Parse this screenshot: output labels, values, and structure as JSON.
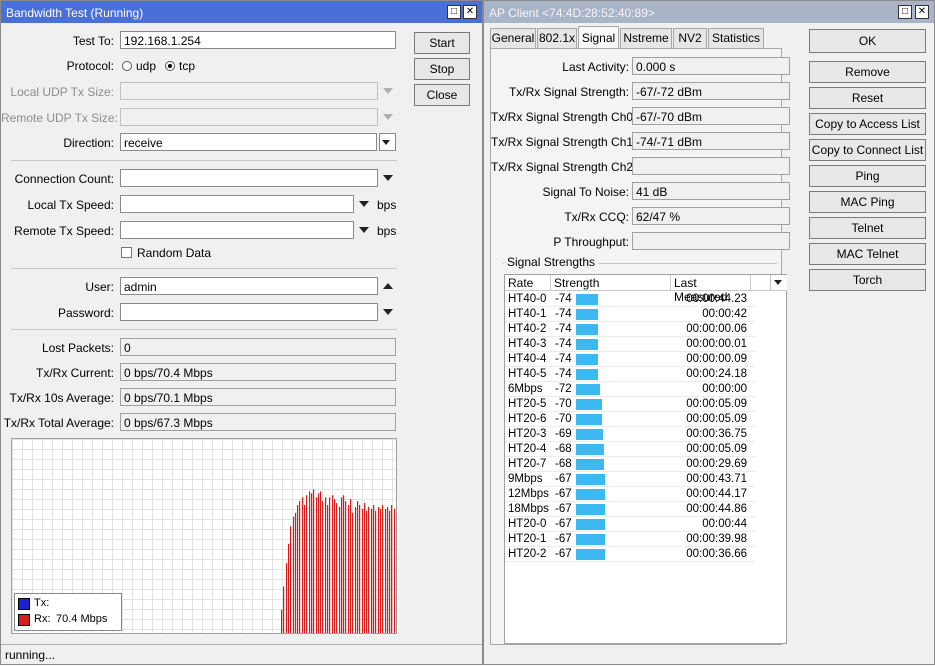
{
  "bandwidth_test": {
    "title": "Bandwidth Test (Running)",
    "test_to_label": "Test To:",
    "test_to_value": "192.168.1.254",
    "protocol_label": "Protocol:",
    "protocol_udp": "udp",
    "protocol_tcp": "tcp",
    "protocol_selected": "tcp",
    "local_udp_tx_size_label": "Local UDP Tx Size:",
    "remote_udp_tx_size_label": "Remote UDP Tx Size:",
    "direction_label": "Direction:",
    "direction_value": "receive",
    "connection_count_label": "Connection Count:",
    "local_tx_speed_label": "Local Tx Speed:",
    "remote_tx_speed_label": "Remote Tx Speed:",
    "bps_unit": "bps",
    "random_data_label": "Random Data",
    "user_label": "User:",
    "user_value": "admin",
    "password_label": "Password:",
    "lost_packets_label": "Lost Packets:",
    "lost_packets_value": "0",
    "txrx_current_label": "Tx/Rx Current:",
    "txrx_current_value": "0 bps/70.4 Mbps",
    "txrx_10s_label": "Tx/Rx 10s Average:",
    "txrx_10s_value": "0 bps/70.1 Mbps",
    "txrx_total_label": "Tx/Rx Total Average:",
    "txrx_total_value": "0 bps/67.3 Mbps",
    "buttons": {
      "start": "Start",
      "stop": "Stop",
      "close": "Close"
    },
    "legend": {
      "tx_label": "Tx:",
      "rx_label": "Rx:",
      "rx_value": "70.4 Mbps"
    },
    "colors": {
      "tx": "#1f1fd6",
      "rx": "#d81c1c"
    },
    "status": "running..."
  },
  "chart_data": {
    "type": "bar",
    "series": [
      {
        "name": "Rx",
        "values": [
          2,
          0,
          0,
          0,
          0,
          0,
          0,
          0,
          0,
          0,
          0,
          0,
          0,
          0,
          0,
          0,
          0,
          0,
          0,
          0,
          0,
          0,
          0,
          0,
          0,
          0,
          0,
          0,
          0,
          0,
          0,
          0,
          0,
          0,
          0,
          0,
          0,
          0,
          0,
          0,
          0,
          0,
          0,
          0,
          0,
          0,
          0,
          0,
          0,
          0,
          0,
          0,
          0,
          0,
          0,
          0,
          0,
          0,
          0,
          0,
          0,
          0,
          0,
          0,
          0,
          0,
          0,
          0,
          0,
          0,
          0,
          0,
          0,
          0,
          0,
          0,
          0,
          0,
          0,
          0,
          0,
          0,
          0,
          0,
          0,
          0,
          0,
          0,
          0,
          0,
          0,
          0,
          0,
          0,
          0,
          0,
          0,
          0,
          0,
          0,
          0,
          0,
          0,
          0,
          0,
          0,
          0,
          0,
          0,
          0,
          0,
          0,
          0,
          0,
          0,
          0,
          0,
          0,
          0,
          0,
          0,
          0,
          0,
          0,
          0,
          0,
          0,
          0,
          0,
          0,
          0,
          0,
          0,
          0,
          0,
          0,
          0,
          0,
          0,
          0,
          0,
          0,
          0,
          0,
          0,
          0,
          0,
          0,
          0,
          0,
          0,
          0,
          0,
          0,
          0,
          0,
          0,
          0,
          0,
          0,
          0,
          0,
          0,
          0,
          0,
          0,
          0,
          0,
          0,
          0,
          0,
          0,
          0,
          0,
          0,
          0,
          0,
          0,
          0,
          0,
          0,
          0,
          0,
          0,
          0,
          0,
          0,
          0,
          0,
          0,
          0,
          0,
          0,
          0,
          0,
          0,
          0,
          0,
          0,
          0,
          0,
          0,
          0,
          0,
          0,
          0,
          0,
          0,
          0,
          0,
          0,
          0,
          0,
          0,
          0,
          0,
          0,
          0,
          0,
          0,
          0,
          0,
          0,
          0,
          0,
          0,
          0,
          0,
          0,
          0,
          0,
          0,
          0,
          0,
          0,
          0,
          0,
          0,
          0,
          0,
          0,
          0,
          0,
          0,
          0,
          0,
          12,
          24,
          36,
          46,
          55,
          60,
          62,
          66,
          68,
          70,
          66,
          71,
          73,
          72,
          74,
          70,
          72,
          73,
          68,
          70,
          66,
          70,
          71,
          69,
          67,
          65,
          70,
          71,
          68,
          66,
          69,
          62,
          65,
          68,
          66,
          64,
          67,
          63,
          65,
          64,
          66,
          63,
          65,
          64,
          66,
          64,
          65,
          63,
          66,
          64
        ]
      },
      {
        "name": "Tx",
        "values": []
      }
    ],
    "ylim": [
      0,
      100
    ]
  },
  "ap_client": {
    "title": "AP Client <74:4D:28:52:40:89>",
    "tabs": [
      "General",
      "802.1x",
      "Signal",
      "Nstreme",
      "NV2",
      "Statistics"
    ],
    "active_tab": "Signal",
    "fields": [
      {
        "label": "Last Activity:",
        "value": "0.000 s"
      },
      {
        "label": "Tx/Rx Signal Strength:",
        "value": "-67/-72 dBm"
      },
      {
        "label": "Tx/Rx Signal Strength Ch0:",
        "value": "-67/-70 dBm"
      },
      {
        "label": "Tx/Rx Signal Strength Ch1:",
        "value": "-74/-71 dBm"
      },
      {
        "label": "Tx/Rx Signal Strength Ch2:",
        "value": ""
      },
      {
        "label": "Signal To Noise:",
        "value": "41 dB"
      },
      {
        "label": "Tx/Rx CCQ:",
        "value": "62/47 %"
      },
      {
        "label": "P Throughput:",
        "value": ""
      }
    ],
    "signal_strengths_title": "Signal Strengths",
    "columns": [
      "Rate",
      "Strength",
      "Last Measured"
    ],
    "rows": [
      {
        "rate": "HT40-0",
        "strength": "-74",
        "last": "00:00:44.23"
      },
      {
        "rate": "HT40-1",
        "strength": "-74",
        "last": "00:00:42"
      },
      {
        "rate": "HT40-2",
        "strength": "-74",
        "last": "00:00:00.06"
      },
      {
        "rate": "HT40-3",
        "strength": "-74",
        "last": "00:00:00.01"
      },
      {
        "rate": "HT40-4",
        "strength": "-74",
        "last": "00:00:00.09"
      },
      {
        "rate": "HT40-5",
        "strength": "-74",
        "last": "00:00:24.18"
      },
      {
        "rate": "6Mbps",
        "strength": "-72",
        "last": "00:00:00"
      },
      {
        "rate": "HT20-5",
        "strength": "-70",
        "last": "00:00:05.09"
      },
      {
        "rate": "HT20-6",
        "strength": "-70",
        "last": "00:00:05.09"
      },
      {
        "rate": "HT20-3",
        "strength": "-69",
        "last": "00:00:36.75"
      },
      {
        "rate": "HT20-4",
        "strength": "-68",
        "last": "00:00:05.09"
      },
      {
        "rate": "HT20-7",
        "strength": "-68",
        "last": "00:00:29.69"
      },
      {
        "rate": "9Mbps",
        "strength": "-67",
        "last": "00:00:43.71"
      },
      {
        "rate": "12Mbps",
        "strength": "-67",
        "last": "00:00:44.17"
      },
      {
        "rate": "18Mbps",
        "strength": "-67",
        "last": "00:00:44.86"
      },
      {
        "rate": "HT20-0",
        "strength": "-67",
        "last": "00:00:44"
      },
      {
        "rate": "HT20-1",
        "strength": "-67",
        "last": "00:00:39.98"
      },
      {
        "rate": "HT20-2",
        "strength": "-67",
        "last": "00:00:36.66"
      }
    ],
    "buttons": [
      "OK",
      "Remove",
      "Reset",
      "Copy to Access List",
      "Copy to Connect List",
      "Ping",
      "MAC Ping",
      "Telnet",
      "MAC Telnet",
      "Torch"
    ],
    "strength_bar_color": "#3bb9f0"
  }
}
